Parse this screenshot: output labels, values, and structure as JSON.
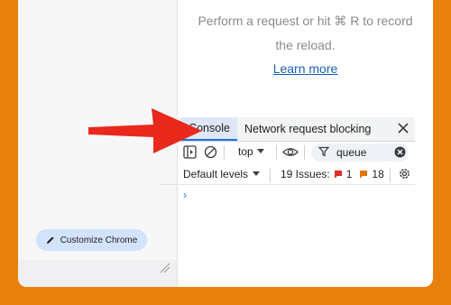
{
  "network_panel": {
    "empty_line1": "Perform a request or hit ⌘ R to record",
    "empty_line2": "the reload.",
    "learn_more": "Learn more"
  },
  "drawer": {
    "tabs": [
      "Console",
      "Network request blocking"
    ],
    "active_tab": "Console"
  },
  "console_toolbar": {
    "context": "top",
    "filter_value": "queue",
    "levels": "Default levels",
    "issues_label": "19 Issues:",
    "errors_count": "1",
    "warnings_count": "18",
    "prompt": "›"
  },
  "sidebar": {
    "customize_button": "Customize Chrome"
  },
  "colors": {
    "background": "#e8800e",
    "accent": "#1a73e8",
    "arrow": "#e8291c",
    "error": "#d93025",
    "warning": "#e37400"
  }
}
